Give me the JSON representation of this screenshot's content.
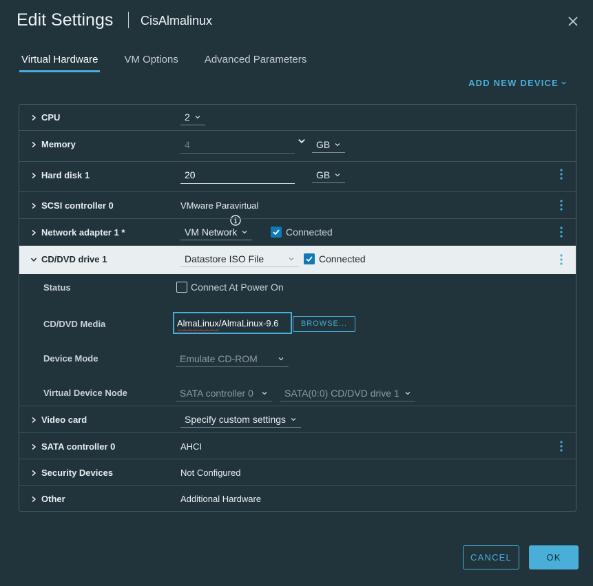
{
  "dialog": {
    "title": "Edit Settings",
    "subtitle": "CisAlmalinux"
  },
  "tabs": [
    {
      "label": "Virtual Hardware",
      "active": true
    },
    {
      "label": "VM Options",
      "active": false
    },
    {
      "label": "Advanced Parameters",
      "active": false
    }
  ],
  "add_device_label": "ADD NEW DEVICE",
  "devices": {
    "cpu": {
      "label": "CPU",
      "value": "2"
    },
    "memory": {
      "label": "Memory",
      "value": "4",
      "unit": "GB"
    },
    "hard_disk": {
      "label": "Hard disk 1",
      "value": "20",
      "unit": "GB"
    },
    "scsi": {
      "label": "SCSI controller 0",
      "value": "VMware Paravirtual"
    },
    "network": {
      "label": "Network adapter 1 *",
      "value": "VM Network",
      "connected_label": "Connected"
    },
    "cddvd": {
      "label": "CD/DVD drive 1",
      "value": "Datastore ISO File",
      "connected_label": "Connected",
      "status": {
        "label": "Status",
        "option_label": "Connect At Power On"
      },
      "media": {
        "label": "CD/DVD Media",
        "value": "AlmaLinux/AlmaLinux-9.6",
        "browse_label": "BROWSE..."
      },
      "device_mode": {
        "label": "Device Mode",
        "value": "Emulate CD-ROM"
      },
      "node": {
        "label": "Virtual Device Node",
        "controller": "SATA controller 0",
        "slot": "SATA(0:0) CD/DVD drive 1"
      }
    },
    "video": {
      "label": "Video card",
      "value": "Specify custom settings"
    },
    "sata": {
      "label": "SATA controller 0",
      "value": "AHCI"
    },
    "security": {
      "label": "Security Devices",
      "value": "Not Configured"
    },
    "other": {
      "label": "Other",
      "value": "Additional Hardware"
    }
  },
  "footer": {
    "cancel_label": "CANCEL",
    "ok_label": "OK"
  },
  "colors": {
    "background": "#21333b",
    "accent": "#49afd9",
    "checkbox": "#0f7ab8"
  }
}
